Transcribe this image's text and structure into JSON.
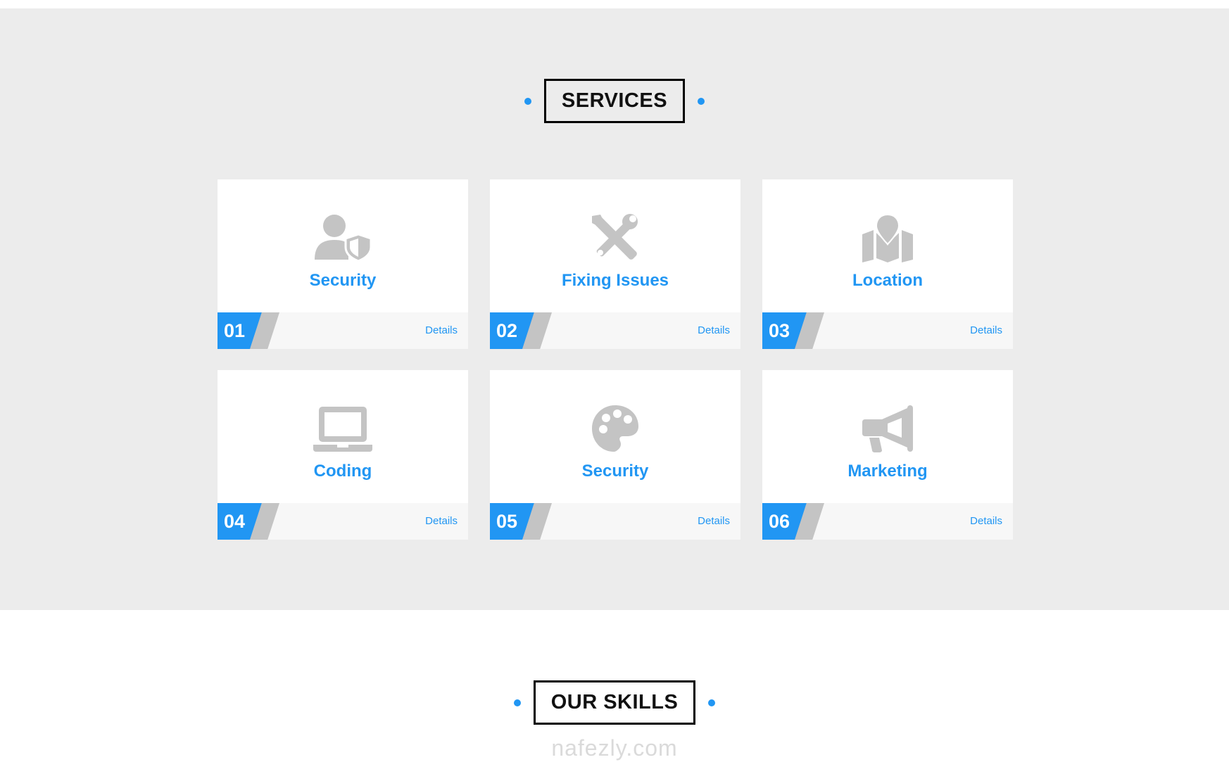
{
  "services": {
    "heading": "SERVICES",
    "cards": [
      {
        "icon": "user-shield-icon",
        "title": "Security",
        "number": "01",
        "details": "Details"
      },
      {
        "icon": "tools-icon",
        "title": "Fixing Issues",
        "number": "02",
        "details": "Details"
      },
      {
        "icon": "map-location-icon",
        "title": "Location",
        "number": "03",
        "details": "Details"
      },
      {
        "icon": "laptop-icon",
        "title": "Coding",
        "number": "04",
        "details": "Details"
      },
      {
        "icon": "palette-icon",
        "title": "Security",
        "number": "05",
        "details": "Details"
      },
      {
        "icon": "megaphone-icon",
        "title": "Marketing",
        "number": "06",
        "details": "Details"
      }
    ]
  },
  "skills": {
    "heading": "OUR SKILLS"
  },
  "watermark": "nafezly.com",
  "colors": {
    "accent": "#2196f3",
    "icon_gray": "#c4c4c4",
    "section_bg": "#ececec"
  }
}
